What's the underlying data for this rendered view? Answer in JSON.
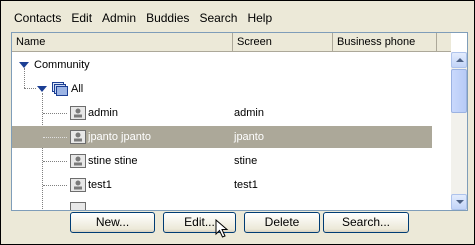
{
  "menu": [
    "Contacts",
    "Edit",
    "Admin",
    "Buddies",
    "Search",
    "Help"
  ],
  "columns": {
    "name": "Name",
    "screen": "Screen",
    "phone": "Business phone"
  },
  "tree": {
    "root_label": "Community",
    "group_label": "All",
    "rows": [
      {
        "name": "admin",
        "screen": "admin",
        "selected": false
      },
      {
        "name": "jpanto jpanto",
        "screen": "jpanto",
        "selected": true
      },
      {
        "name": "stine stine",
        "screen": "stine",
        "selected": false
      },
      {
        "name": "test1",
        "screen": "test1",
        "selected": false
      }
    ]
  },
  "buttons": {
    "new": "New...",
    "edit": "Edit...",
    "delete": "Delete",
    "search": "Search..."
  },
  "colors": {
    "selection": "#aca899",
    "expander": "#1c3f94",
    "button_border": "#003c74"
  }
}
